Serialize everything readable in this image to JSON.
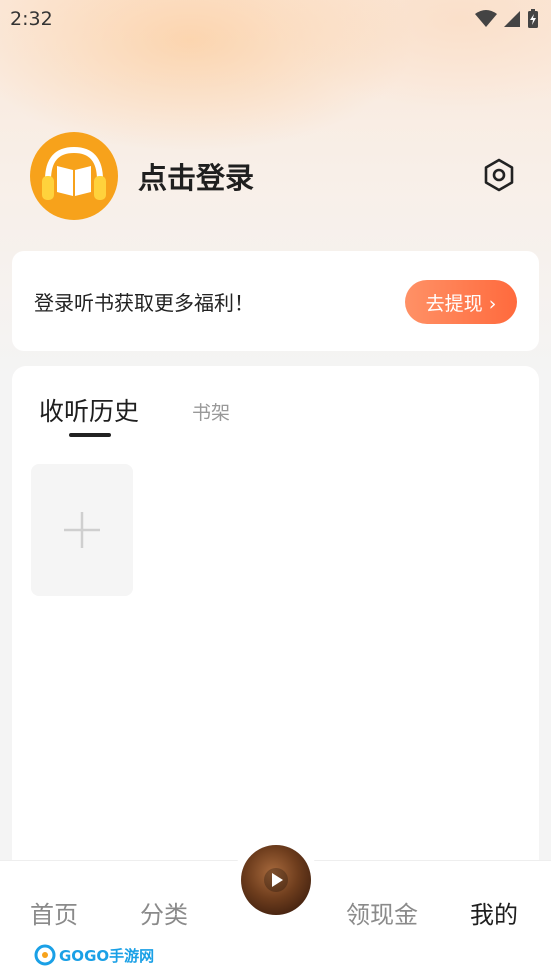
{
  "status_bar": {
    "time": "2:32"
  },
  "profile": {
    "login_label": "点击登录"
  },
  "promo": {
    "text": "登录听书获取更多福利！",
    "button_label": "去提现 ›"
  },
  "library": {
    "tabs": [
      {
        "label": "收听历史"
      },
      {
        "label": "书架"
      }
    ]
  },
  "bottom_nav": {
    "items": [
      {
        "label": "首页"
      },
      {
        "label": "分类"
      },
      {
        "label": "领现金"
      },
      {
        "label": "我的"
      }
    ]
  },
  "watermark": {
    "text": "GOGO手游网"
  },
  "colors": {
    "avatar": "#f7a21b",
    "promo_button_start": "#ff9166",
    "promo_button_end": "#ff6a3d"
  }
}
